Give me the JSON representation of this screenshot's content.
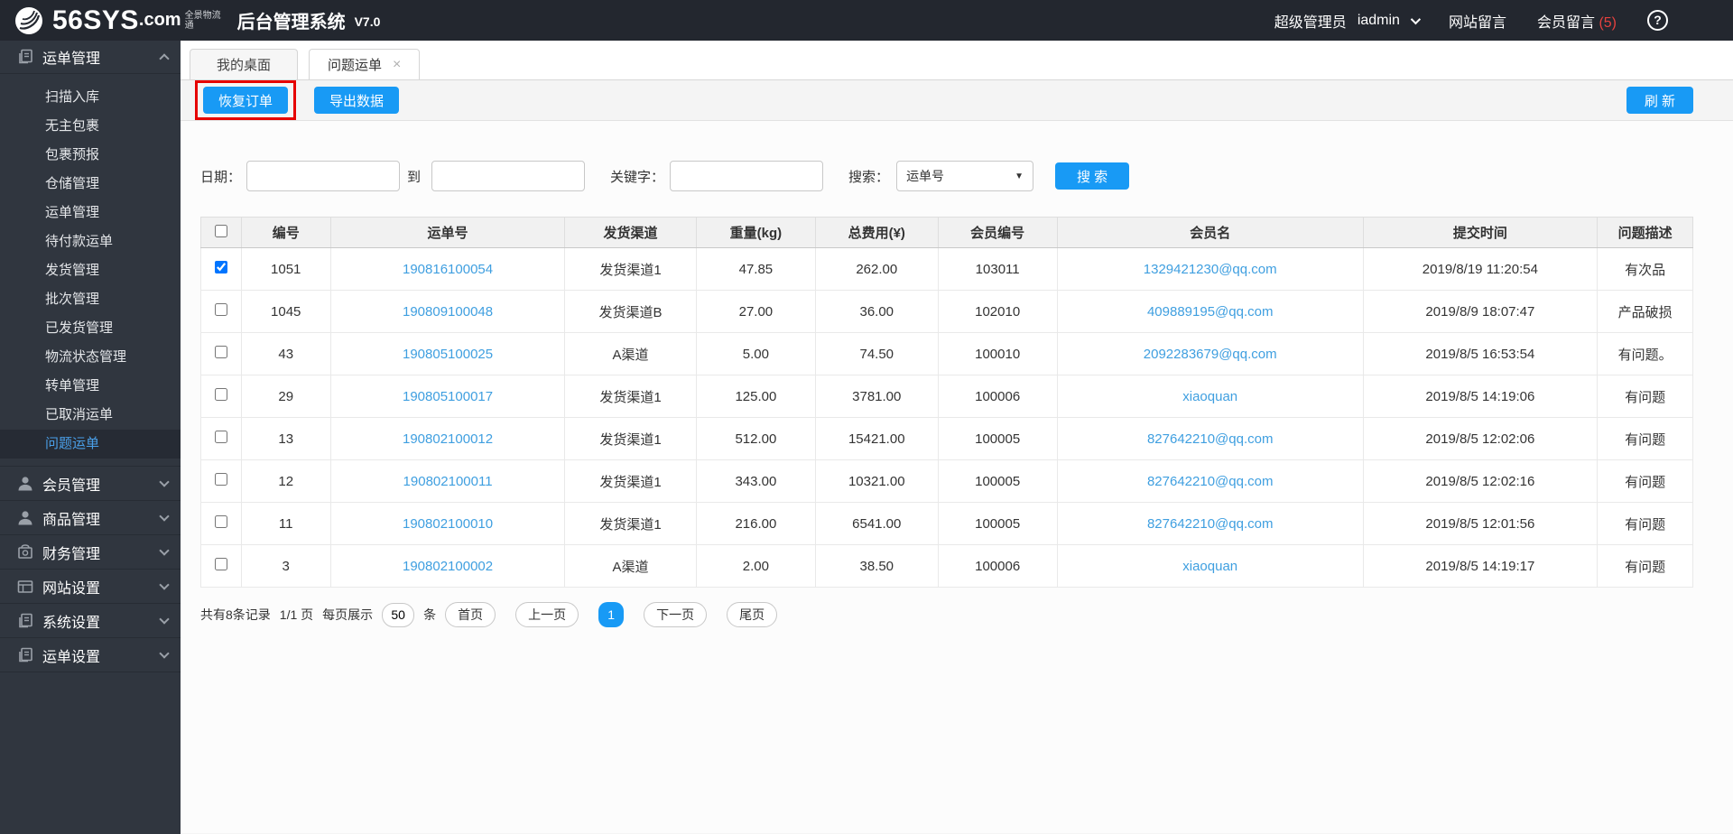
{
  "topbar": {
    "logo_text": "56SYS",
    "logo_suffix": ".com",
    "logo_tagline": "全景物流通",
    "app_title": "后台管理系统",
    "version": "V7.0",
    "role": "超级管理员",
    "username": "iadmin",
    "site_messages": "网站留言",
    "member_messages": "会员留言",
    "member_message_count": "(5)"
  },
  "sidebar": {
    "sections": [
      {
        "label": "运单管理",
        "icon": "doc-icon",
        "expanded": true,
        "items": [
          {
            "label": "扫描入库"
          },
          {
            "label": "无主包裹"
          },
          {
            "label": "包裹预报"
          },
          {
            "label": "仓储管理"
          },
          {
            "label": "运单管理"
          },
          {
            "label": "待付款运单"
          },
          {
            "label": "发货管理"
          },
          {
            "label": "批次管理"
          },
          {
            "label": "已发货管理"
          },
          {
            "label": "物流状态管理"
          },
          {
            "label": "转单管理"
          },
          {
            "label": "已取消运单"
          },
          {
            "label": "问题运单",
            "active": true
          }
        ]
      },
      {
        "label": "会员管理",
        "icon": "user-icon"
      },
      {
        "label": "商品管理",
        "icon": "user-icon"
      },
      {
        "label": "财务管理",
        "icon": "bank-icon"
      },
      {
        "label": "网站设置",
        "icon": "layout-icon"
      },
      {
        "label": "系统设置",
        "icon": "doc-icon"
      },
      {
        "label": "运单设置",
        "icon": "doc-icon"
      }
    ]
  },
  "tabs": [
    {
      "label": "我的桌面"
    },
    {
      "label": "问题运单",
      "active": true,
      "closable": true,
      "close_glyph": "×"
    }
  ],
  "toolbar": {
    "restore_label": "恢复订单",
    "export_label": "导出数据",
    "refresh_label": "刷 新"
  },
  "filters": {
    "date_label": "日期：",
    "to_label": "到",
    "keyword_label": "关键字：",
    "search_by_label": "搜索：",
    "search_select_value": "运单号",
    "select_caret": "▼",
    "search_button": "搜 索"
  },
  "table": {
    "columns": [
      "编号",
      "运单号",
      "发货渠道",
      "重量(kg)",
      "总费用(¥)",
      "会员编号",
      "会员名",
      "提交时间",
      "问题描述"
    ],
    "rows": [
      {
        "checked": true,
        "id": "1051",
        "waybill": "190816100054",
        "channel": "发货渠道1",
        "weight": "47.85",
        "fee": "262.00",
        "member_id": "103011",
        "member": "1329421230@qq.com",
        "time": "2019/8/19 11:20:54",
        "issue": "有次品"
      },
      {
        "checked": false,
        "id": "1045",
        "waybill": "190809100048",
        "channel": "发货渠道B",
        "weight": "27.00",
        "fee": "36.00",
        "member_id": "102010",
        "member": "409889195@qq.com",
        "time": "2019/8/9 18:07:47",
        "issue": "产品破损"
      },
      {
        "checked": false,
        "id": "43",
        "waybill": "190805100025",
        "channel": "A渠道",
        "weight": "5.00",
        "fee": "74.50",
        "member_id": "100010",
        "member": "2092283679@qq.com",
        "time": "2019/8/5 16:53:54",
        "issue": "有问题。"
      },
      {
        "checked": false,
        "id": "29",
        "waybill": "190805100017",
        "channel": "发货渠道1",
        "weight": "125.00",
        "fee": "3781.00",
        "member_id": "100006",
        "member": "xiaoquan",
        "time": "2019/8/5 14:19:06",
        "issue": "有问题"
      },
      {
        "checked": false,
        "id": "13",
        "waybill": "190802100012",
        "channel": "发货渠道1",
        "weight": "512.00",
        "fee": "15421.00",
        "member_id": "100005",
        "member": "827642210@qq.com",
        "time": "2019/8/5 12:02:06",
        "issue": "有问题"
      },
      {
        "checked": false,
        "id": "12",
        "waybill": "190802100011",
        "channel": "发货渠道1",
        "weight": "343.00",
        "fee": "10321.00",
        "member_id": "100005",
        "member": "827642210@qq.com",
        "time": "2019/8/5 12:02:16",
        "issue": "有问题"
      },
      {
        "checked": false,
        "id": "11",
        "waybill": "190802100010",
        "channel": "发货渠道1",
        "weight": "216.00",
        "fee": "6541.00",
        "member_id": "100005",
        "member": "827642210@qq.com",
        "time": "2019/8/5 12:01:56",
        "issue": "有问题"
      },
      {
        "checked": false,
        "id": "3",
        "waybill": "190802100002",
        "channel": "A渠道",
        "weight": "2.00",
        "fee": "38.50",
        "member_id": "100006",
        "member": "xiaoquan",
        "time": "2019/8/5 14:19:17",
        "issue": "有问题"
      }
    ]
  },
  "pagination": {
    "total_text": "共有8条记录",
    "page_info": "1/1 页",
    "per_page_prefix": "每页展示",
    "per_page_value": "50",
    "per_page_suffix": "条",
    "first": "首页",
    "prev": "上一页",
    "current": "1",
    "next": "下一页",
    "last": "尾页"
  },
  "colors": {
    "accent_blue": "#189af5",
    "link_blue": "#3f9fe0",
    "annotation_red": "#e60000",
    "badge_red": "#e5413e",
    "topbar_bg": "#23272f",
    "sidebar_bg": "#30363f"
  }
}
